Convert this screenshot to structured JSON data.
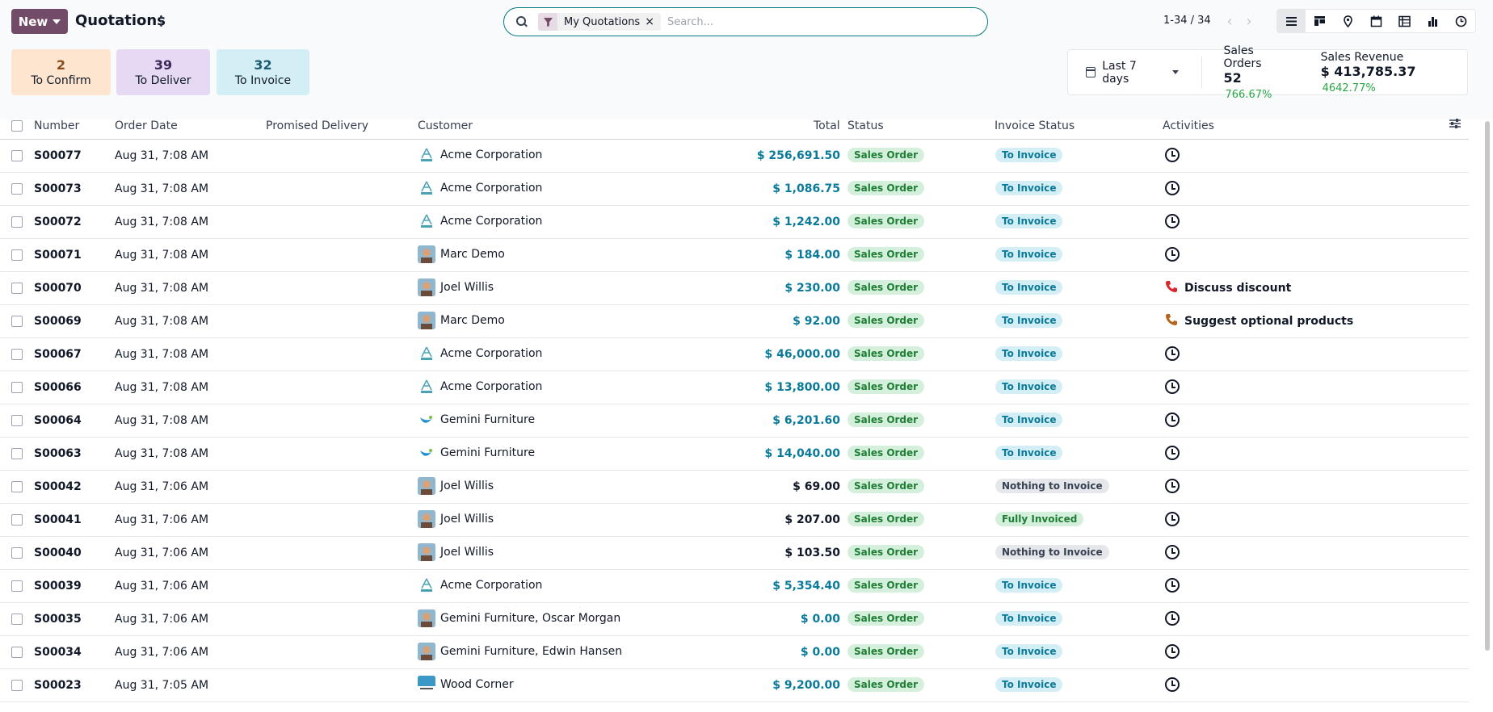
{
  "header": {
    "new_label": "New",
    "title": "Quotations"
  },
  "search": {
    "facet": "My Quotations",
    "placeholder": "Search..."
  },
  "pager": {
    "value": "1-34 / 34"
  },
  "tiles": [
    {
      "num": "2",
      "label": "To Confirm",
      "bg": "#fde5cf",
      "color": "#8a4b1c"
    },
    {
      "num": "39",
      "label": "To Deliver",
      "bg": "#e6d9f3",
      "color": "#3b2a57"
    },
    {
      "num": "32",
      "label": "To Invoice",
      "bg": "#d3eef4",
      "color": "#1b5c70"
    }
  ],
  "kpi": {
    "date_filter": "Last 7 days",
    "sales_orders_label": "Sales Orders",
    "sales_orders_value": "52",
    "sales_orders_delta": "766.67%",
    "revenue_label": "Sales Revenue",
    "revenue_value": "$ 413,785.37",
    "revenue_delta": "4642.77%"
  },
  "columns": {
    "number": "Number",
    "order_date": "Order Date",
    "promised": "Promised Delivery",
    "customer": "Customer",
    "total": "Total",
    "status": "Status",
    "invoice_status": "Invoice Status",
    "activities": "Activities"
  },
  "rows": [
    {
      "number": "S00077",
      "date": "Aug 31, 7:08 AM",
      "customer": "Acme Corporation",
      "avatar": "acme",
      "total": "$ 256,691.50",
      "total_color": "#0a7a9a",
      "status": "Sales Order",
      "invoice": "To Invoice",
      "invoice_type": "toinv",
      "activity": ""
    },
    {
      "number": "S00073",
      "date": "Aug 31, 7:08 AM",
      "customer": "Acme Corporation",
      "avatar": "acme",
      "total": "$ 1,086.75",
      "total_color": "#0a7a9a",
      "status": "Sales Order",
      "invoice": "To Invoice",
      "invoice_type": "toinv",
      "activity": ""
    },
    {
      "number": "S00072",
      "date": "Aug 31, 7:08 AM",
      "customer": "Acme Corporation",
      "avatar": "acme",
      "total": "$ 1,242.00",
      "total_color": "#0a7a9a",
      "status": "Sales Order",
      "invoice": "To Invoice",
      "invoice_type": "toinv",
      "activity": ""
    },
    {
      "number": "S00071",
      "date": "Aug 31, 7:08 AM",
      "customer": "Marc Demo",
      "avatar": "person",
      "total": "$ 184.00",
      "total_color": "#0a7a9a",
      "status": "Sales Order",
      "invoice": "To Invoice",
      "invoice_type": "toinv",
      "activity": ""
    },
    {
      "number": "S00070",
      "date": "Aug 31, 7:08 AM",
      "customer": "Joel Willis",
      "avatar": "person",
      "total": "$ 230.00",
      "total_color": "#0a7a9a",
      "status": "Sales Order",
      "invoice": "To Invoice",
      "invoice_type": "toinv",
      "activity": "Discuss discount",
      "activity_color": "#d9262c"
    },
    {
      "number": "S00069",
      "date": "Aug 31, 7:08 AM",
      "customer": "Marc Demo",
      "avatar": "person",
      "total": "$ 92.00",
      "total_color": "#0a7a9a",
      "status": "Sales Order",
      "invoice": "To Invoice",
      "invoice_type": "toinv",
      "activity": "Suggest optional products",
      "activity_color": "#b5651d"
    },
    {
      "number": "S00067",
      "date": "Aug 31, 7:08 AM",
      "customer": "Acme Corporation",
      "avatar": "acme",
      "total": "$ 46,000.00",
      "total_color": "#0a7a9a",
      "status": "Sales Order",
      "invoice": "To Invoice",
      "invoice_type": "toinv",
      "activity": ""
    },
    {
      "number": "S00066",
      "date": "Aug 31, 7:08 AM",
      "customer": "Acme Corporation",
      "avatar": "acme",
      "total": "$ 13,800.00",
      "total_color": "#0a7a9a",
      "status": "Sales Order",
      "invoice": "To Invoice",
      "invoice_type": "toinv",
      "activity": ""
    },
    {
      "number": "S00064",
      "date": "Aug 31, 7:08 AM",
      "customer": "Gemini Furniture",
      "avatar": "gemini",
      "total": "$ 6,201.60",
      "total_color": "#0a7a9a",
      "status": "Sales Order",
      "invoice": "To Invoice",
      "invoice_type": "toinv",
      "activity": ""
    },
    {
      "number": "S00063",
      "date": "Aug 31, 7:08 AM",
      "customer": "Gemini Furniture",
      "avatar": "gemini",
      "total": "$ 14,040.00",
      "total_color": "#0a7a9a",
      "status": "Sales Order",
      "invoice": "To Invoice",
      "invoice_type": "toinv",
      "activity": ""
    },
    {
      "number": "S00042",
      "date": "Aug 31, 7:06 AM",
      "customer": "Joel Willis",
      "avatar": "person",
      "total": "$ 69.00",
      "total_color": "#111827",
      "status": "Sales Order",
      "invoice": "Nothing to Invoice",
      "invoice_type": "nothing",
      "activity": ""
    },
    {
      "number": "S00041",
      "date": "Aug 31, 7:06 AM",
      "customer": "Joel Willis",
      "avatar": "person",
      "total": "$ 207.00",
      "total_color": "#111827",
      "status": "Sales Order",
      "invoice": "Fully Invoiced",
      "invoice_type": "fully",
      "activity": ""
    },
    {
      "number": "S00040",
      "date": "Aug 31, 7:06 AM",
      "customer": "Joel Willis",
      "avatar": "person",
      "total": "$ 103.50",
      "total_color": "#111827",
      "status": "Sales Order",
      "invoice": "Nothing to Invoice",
      "invoice_type": "nothing",
      "activity": ""
    },
    {
      "number": "S00039",
      "date": "Aug 31, 7:06 AM",
      "customer": "Acme Corporation",
      "avatar": "acme",
      "total": "$ 5,354.40",
      "total_color": "#0a7a9a",
      "status": "Sales Order",
      "invoice": "To Invoice",
      "invoice_type": "toinv",
      "activity": ""
    },
    {
      "number": "S00035",
      "date": "Aug 31, 7:06 AM",
      "customer": "Gemini Furniture, Oscar Morgan",
      "avatar": "person",
      "total": "$ 0.00",
      "total_color": "#0a7a9a",
      "status": "Sales Order",
      "invoice": "To Invoice",
      "invoice_type": "toinv",
      "activity": ""
    },
    {
      "number": "S00034",
      "date": "Aug 31, 7:06 AM",
      "customer": "Gemini Furniture, Edwin Hansen",
      "avatar": "person",
      "total": "$ 0.00",
      "total_color": "#0a7a9a",
      "status": "Sales Order",
      "invoice": "To Invoice",
      "invoice_type": "toinv",
      "activity": ""
    },
    {
      "number": "S00023",
      "date": "Aug 31, 7:05 AM",
      "customer": "Wood Corner",
      "avatar": "wood",
      "total": "$ 9,200.00",
      "total_color": "#0a7a9a",
      "status": "Sales Order",
      "invoice": "To Invoice",
      "invoice_type": "toinv",
      "activity": ""
    }
  ]
}
